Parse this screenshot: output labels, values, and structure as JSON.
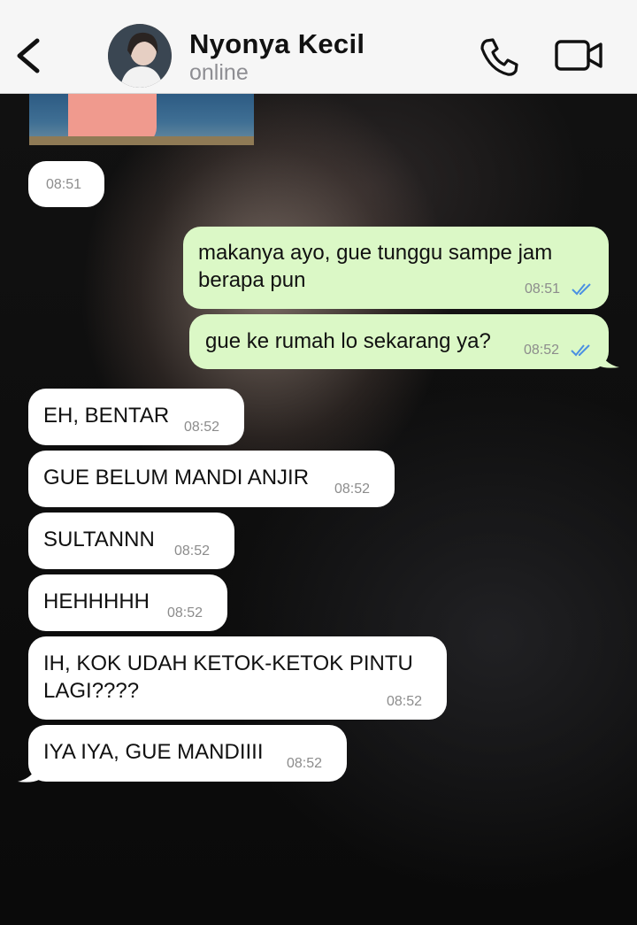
{
  "header": {
    "contact_name": "Nyonya Kecil",
    "status": "online",
    "icons": [
      "chevron-left-icon",
      "phone-icon",
      "video-camera-icon"
    ]
  },
  "colors": {
    "header_bg": "#f6f6f6",
    "incoming_bubble": "#ffffff",
    "outgoing_bubble": "#dbf8c6",
    "read_ticks": "#4a90e2",
    "timestamp": "#8c8c8c"
  },
  "messages": [
    {
      "direction": "in",
      "text": "",
      "time": "08:51"
    },
    {
      "direction": "out",
      "lines": [
        "makanya ayo, gue tunggu sampe jam",
        "berapa pun"
      ],
      "time": "08:51",
      "read": true
    },
    {
      "direction": "out",
      "text": "gue ke rumah lo sekarang ya?",
      "time": "08:52",
      "read": true
    },
    {
      "direction": "in",
      "text": "EH, BENTAR",
      "time": "08:52"
    },
    {
      "direction": "in",
      "text": "GUE BELUM MANDI ANJIR",
      "time": "08:52"
    },
    {
      "direction": "in",
      "text": "SULTANNN",
      "time": "08:52"
    },
    {
      "direction": "in",
      "text": "HEHHHHH",
      "time": "08:52"
    },
    {
      "direction": "in",
      "lines": [
        "IH, KOK UDAH KETOK-KETOK PINTU",
        "LAGI????"
      ],
      "time": "08:52"
    },
    {
      "direction": "in",
      "text": "IYA IYA, GUE MANDIIII",
      "time": "08:52"
    }
  ]
}
